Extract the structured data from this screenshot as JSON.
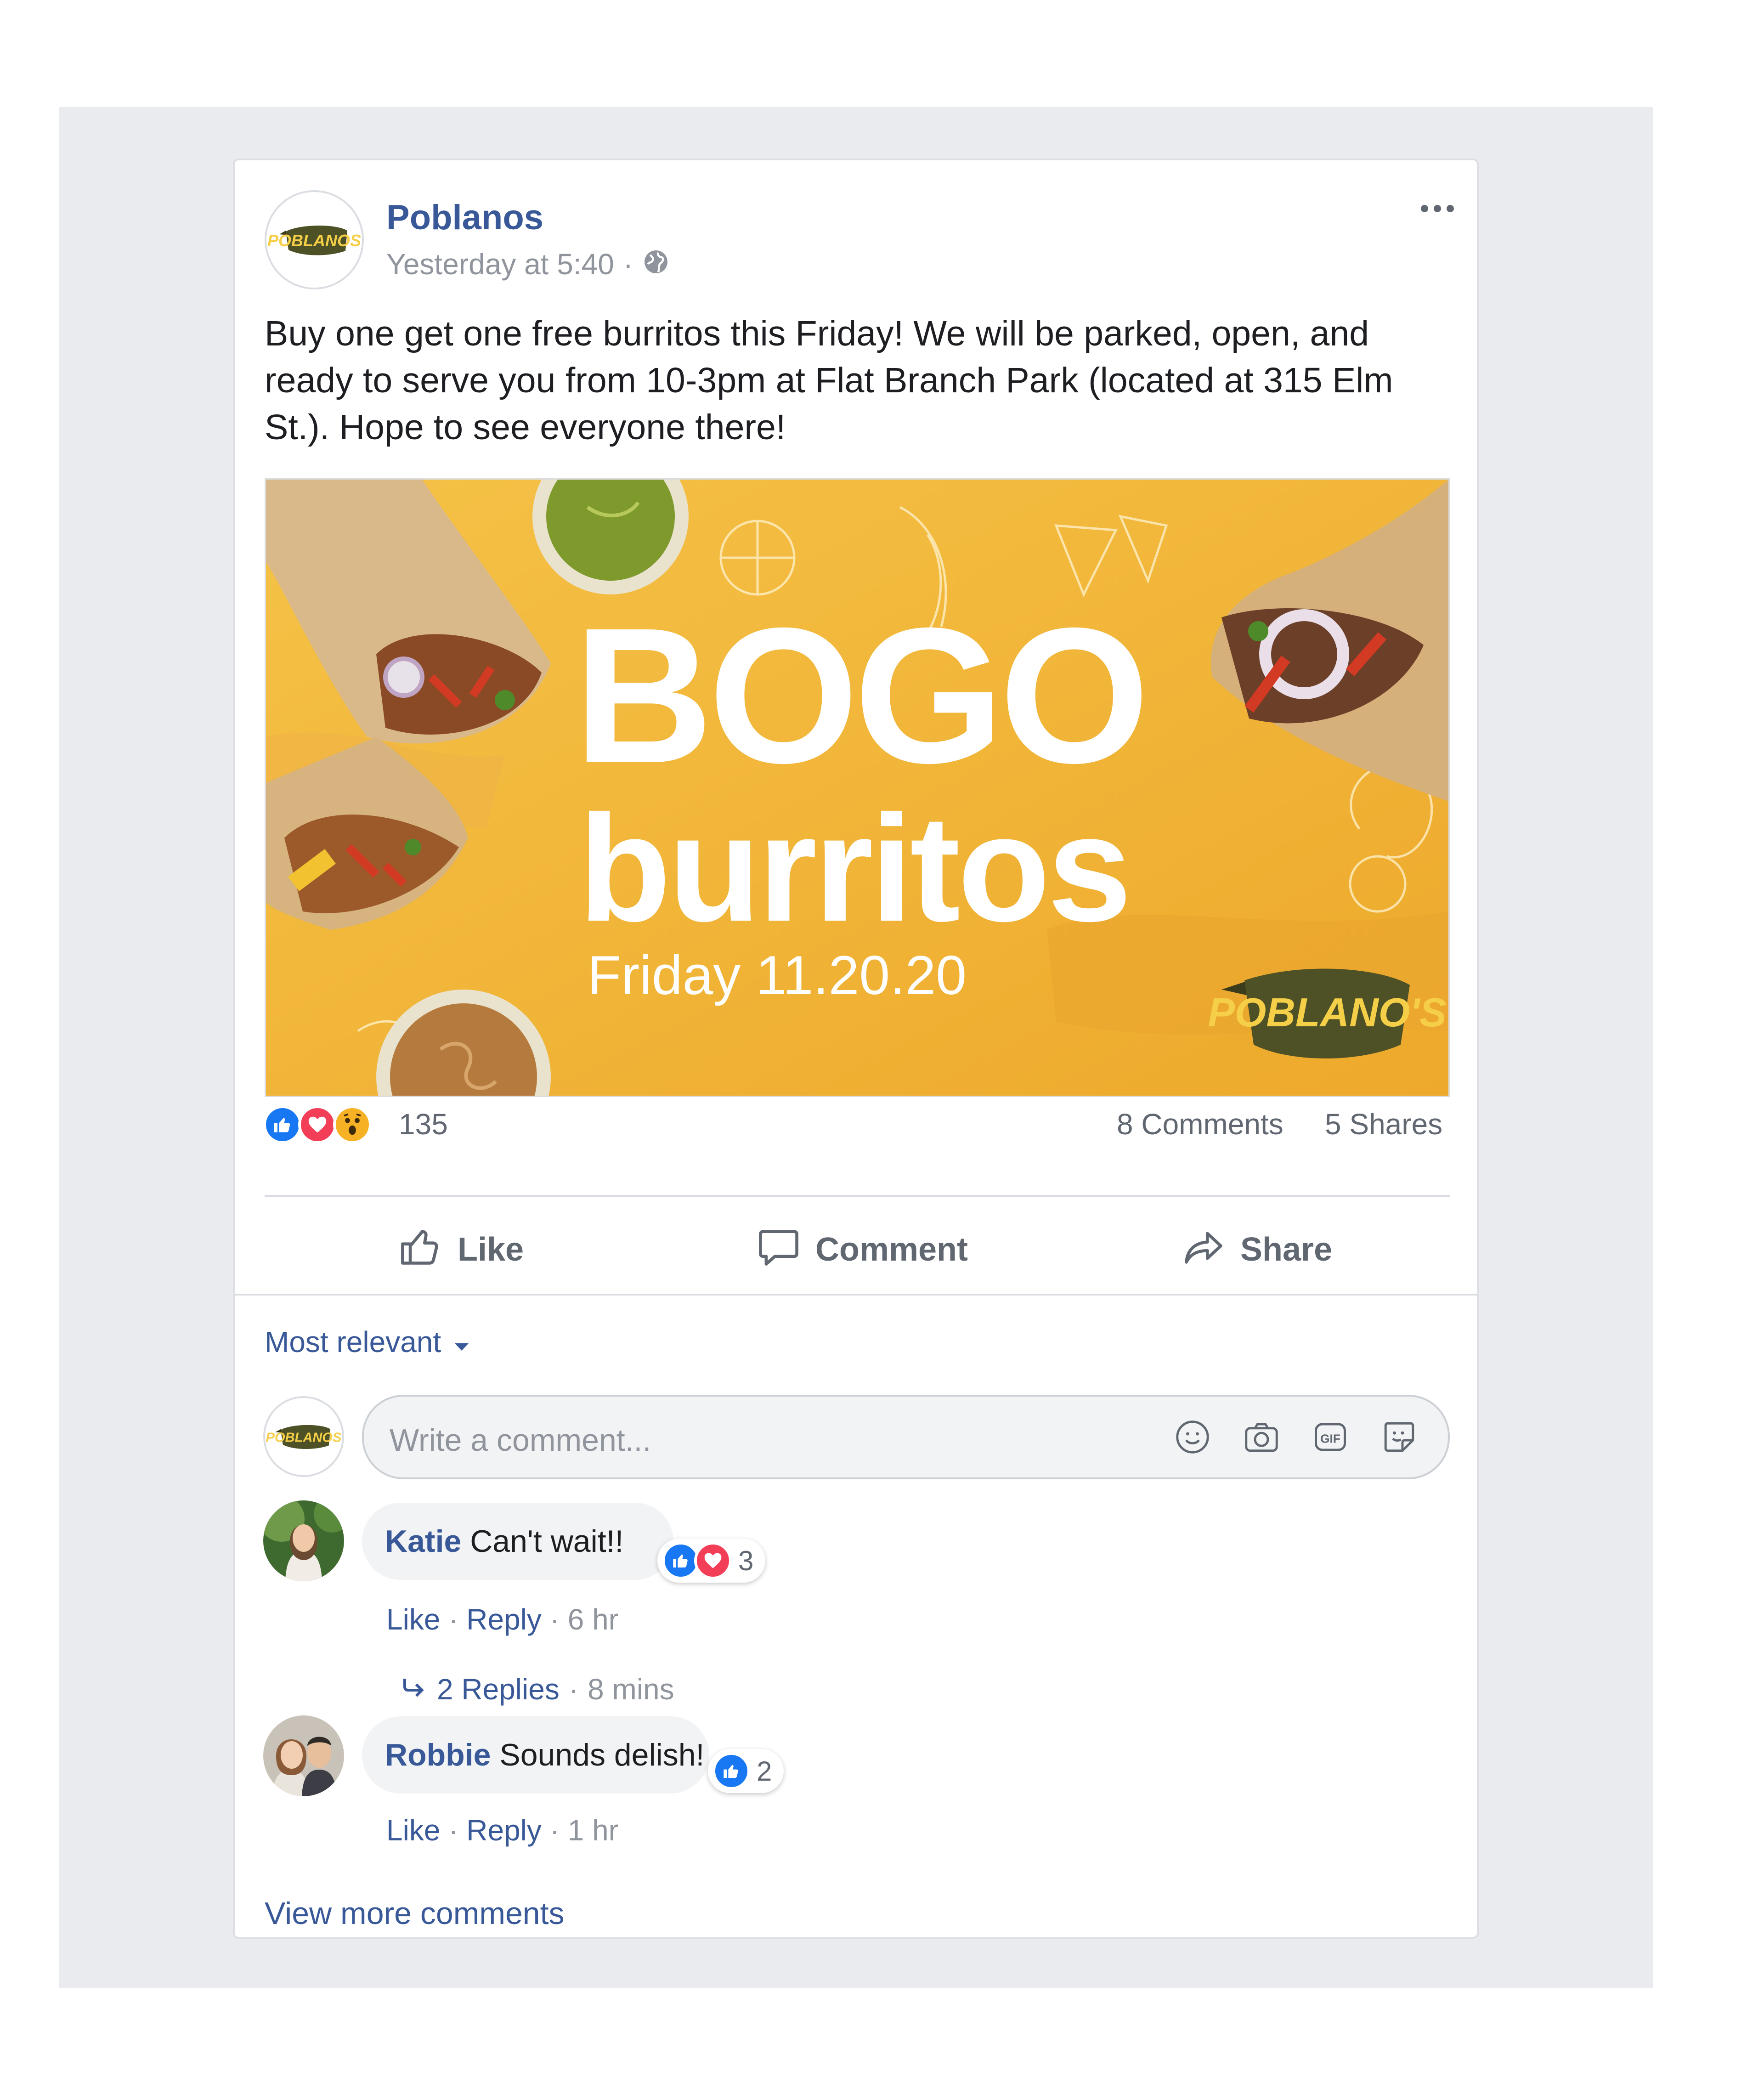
{
  "post": {
    "page_name": "Poblanos",
    "timestamp": "Yesterday at 5:40",
    "separator": "·",
    "privacy_icon": "globe-icon",
    "more_icon": "more-options-icon",
    "text": "Buy one get one free burritos this Friday! We will be parked, open, and ready to serve you from 10-3pm at Flat Branch Park (located at 315 Elm St.). Hope to see everyone there!",
    "logo_text": "POBLANOS",
    "image": {
      "headline_1": "BOGO",
      "headline_2": "burritos",
      "date_line": "Friday 11.20.20",
      "logo_text": "POBLANO'S",
      "background_color": "#f2b233"
    }
  },
  "stats": {
    "reactions": [
      "like",
      "love",
      "wow"
    ],
    "reaction_count": "135",
    "comments": "8 Comments",
    "shares": "5 Shares"
  },
  "actions": {
    "like": "Like",
    "comment": "Comment",
    "share": "Share"
  },
  "comments_section": {
    "sort_label": "Most relevant",
    "input_placeholder": "Write a comment...",
    "input_icons": [
      "smiley-icon",
      "camera-icon",
      "gif-icon",
      "sticker-icon"
    ],
    "gif_label": "GIF",
    "comments": [
      {
        "author": "Katie",
        "text": "Can't wait!!",
        "reactions": [
          "like",
          "love"
        ],
        "reaction_count": "3",
        "like_label": "Like",
        "reply_label": "Reply",
        "time": "6 hr",
        "replies_label": "2 Replies",
        "replies_time": "8 mins"
      },
      {
        "author": "Robbie",
        "text": "Sounds delish!",
        "reactions": [
          "like"
        ],
        "reaction_count": "2",
        "like_label": "Like",
        "reply_label": "Reply",
        "time": "1 hr"
      }
    ],
    "view_more": "View more comments"
  },
  "colors": {
    "link_blue": "#385898",
    "like_blue": "#1877f2",
    "love_red": "#f33e58",
    "wow_yellow": "#f7b125",
    "backdrop": "#e9ebee"
  }
}
